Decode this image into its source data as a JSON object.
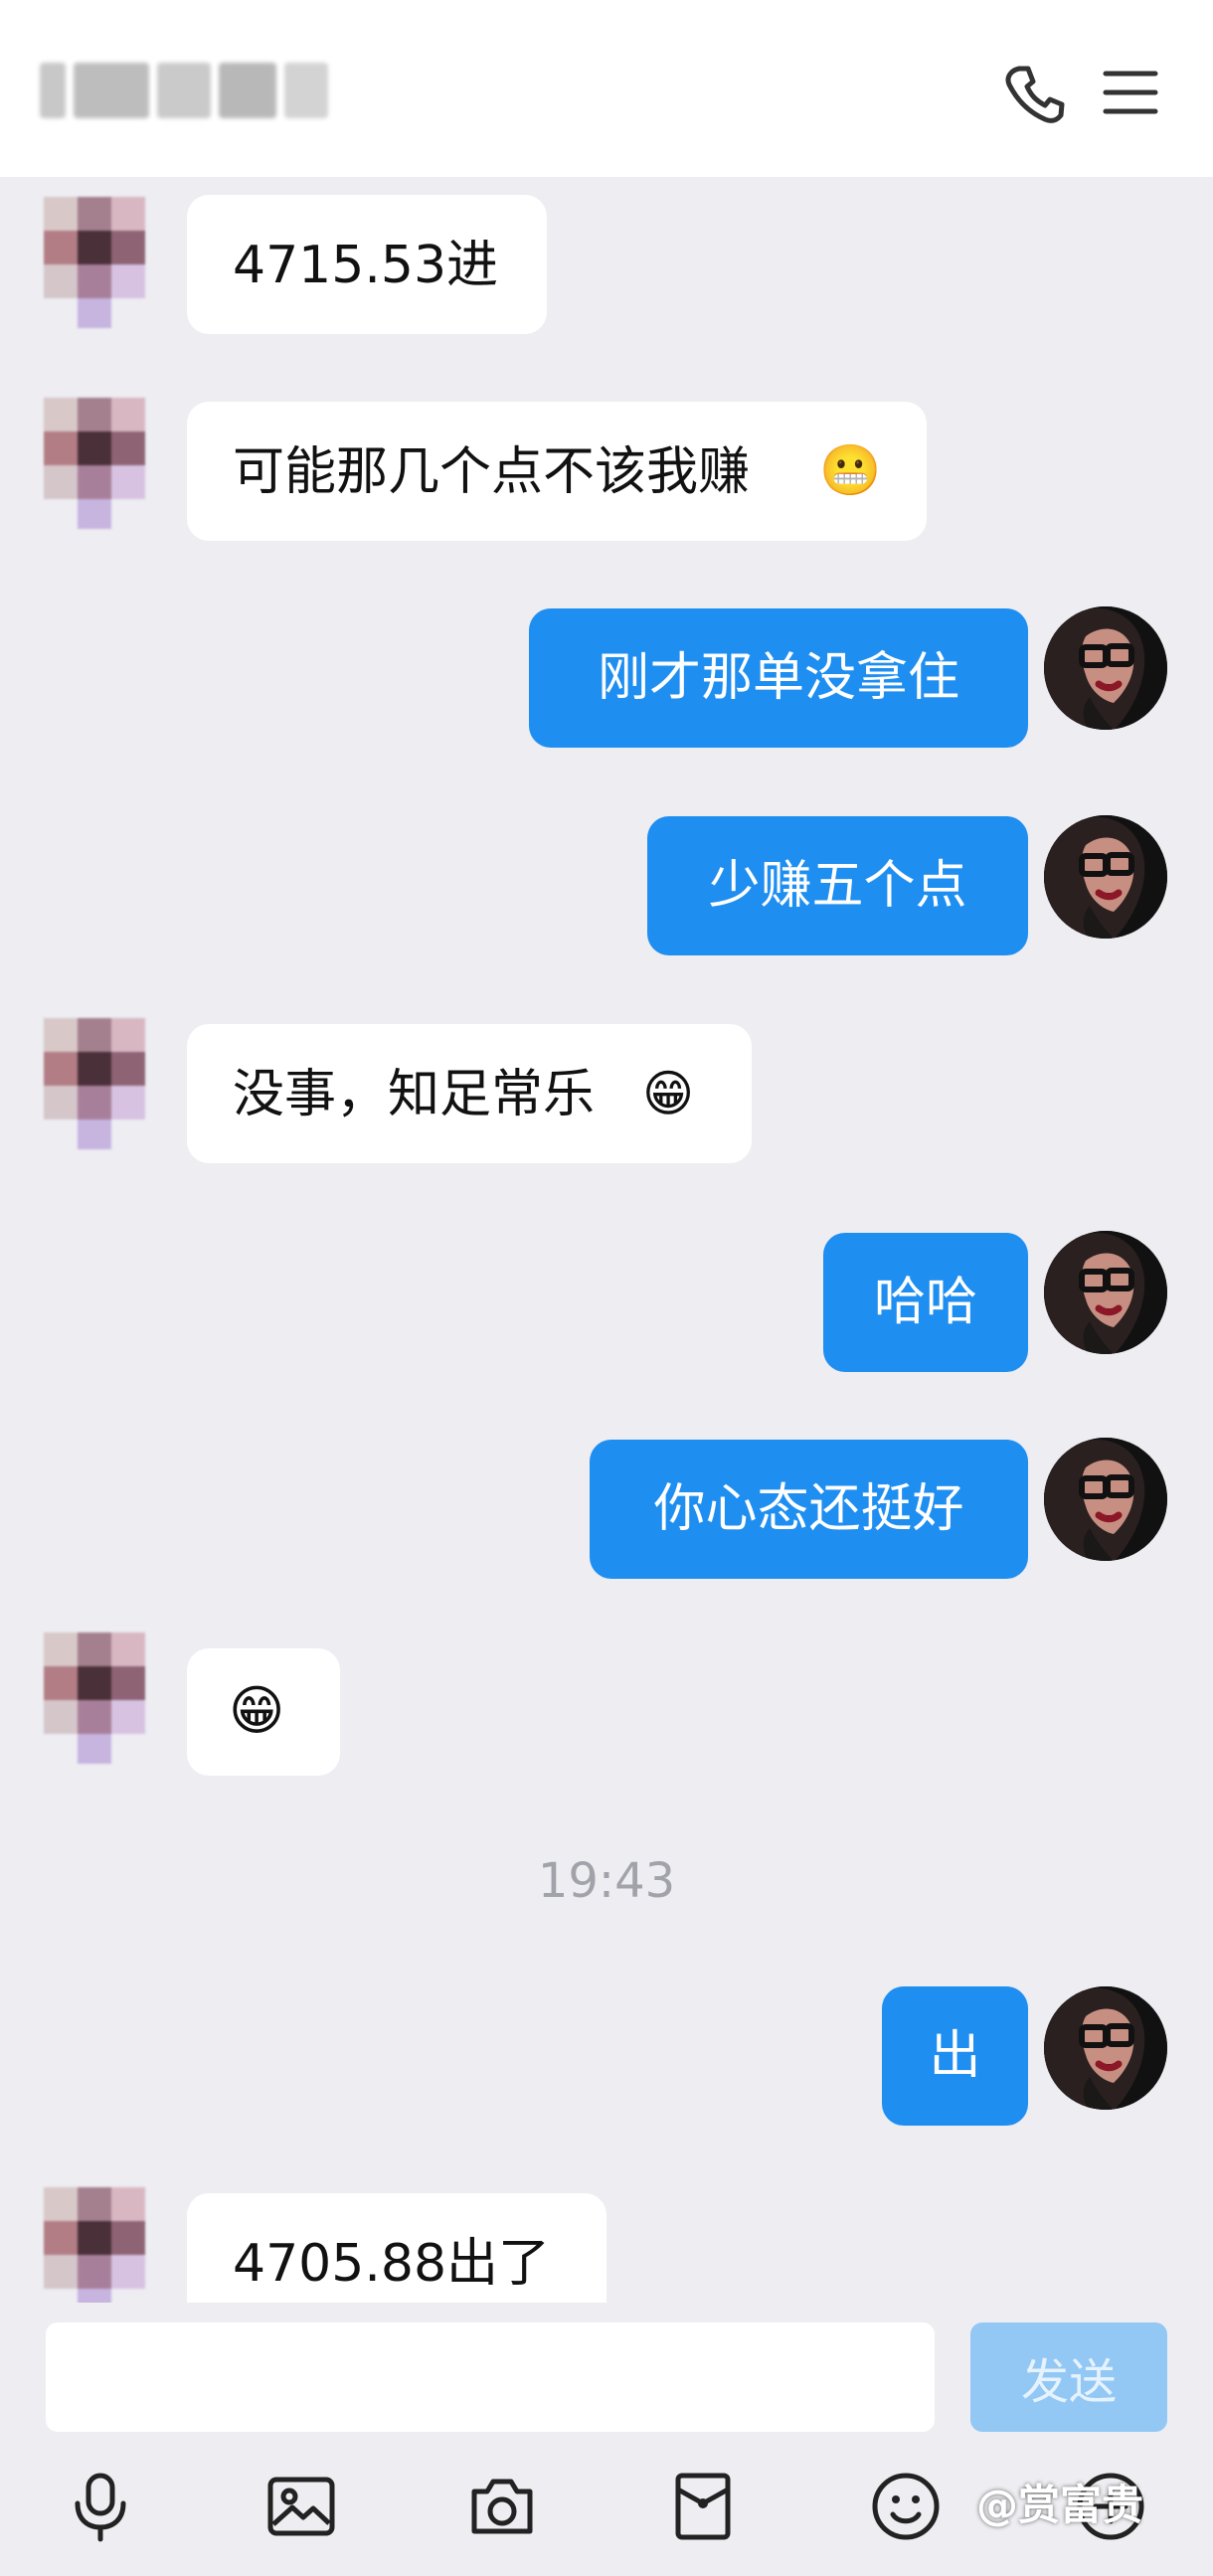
{
  "header": {
    "contact_name": "",
    "call_icon": "phone-icon",
    "menu_icon": "menu-icon"
  },
  "messages": [
    {
      "side": "in",
      "text": "4715.53进",
      "emoji": ""
    },
    {
      "side": "in",
      "text": "可能那几个点不该我赚",
      "emoji": "😬"
    },
    {
      "side": "out",
      "text": "刚才那单没拿住"
    },
    {
      "side": "out",
      "text": "少赚五个点"
    },
    {
      "side": "in",
      "text": "没事，知足常乐",
      "emoji": "😁"
    },
    {
      "side": "out",
      "text": "哈哈"
    },
    {
      "side": "out",
      "text": "你心态还挺好"
    },
    {
      "side": "in",
      "text": "",
      "emoji": "😁"
    },
    {
      "side": "time",
      "text": "19:43"
    },
    {
      "side": "out",
      "text": "出"
    },
    {
      "side": "in",
      "text": "4705.88出了",
      "emoji": ""
    }
  ],
  "composer": {
    "value": "",
    "send_label": "发送"
  },
  "toolbar": {
    "icons": [
      "microphone-icon",
      "image-icon",
      "camera-icon",
      "red-packet-icon",
      "emoji-icon",
      "add-icon"
    ]
  },
  "watermark": "@赏富贵"
}
